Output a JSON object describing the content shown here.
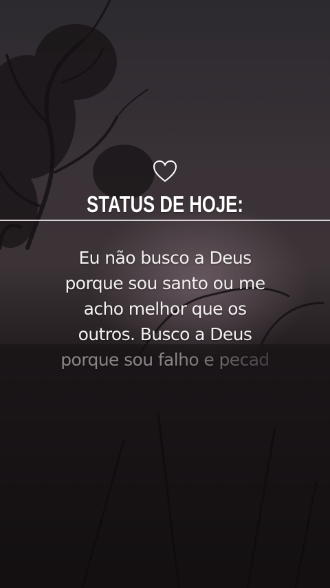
{
  "header": {
    "icon": "heart-outline-icon",
    "title": "STATUS DE HOJE:"
  },
  "quote": {
    "line_1": "Eu não busco a Deus",
    "line_2": "porque sou santo ou me",
    "line_3": "acho melhor que os",
    "line_4": "outros. Busco a Deus",
    "line_5": "porque sou falho e pecad"
  },
  "colors": {
    "text": "#ffffff",
    "divider": "#d9d3d6",
    "background_dark": "#1b1719",
    "glow": "#8c7882"
  }
}
